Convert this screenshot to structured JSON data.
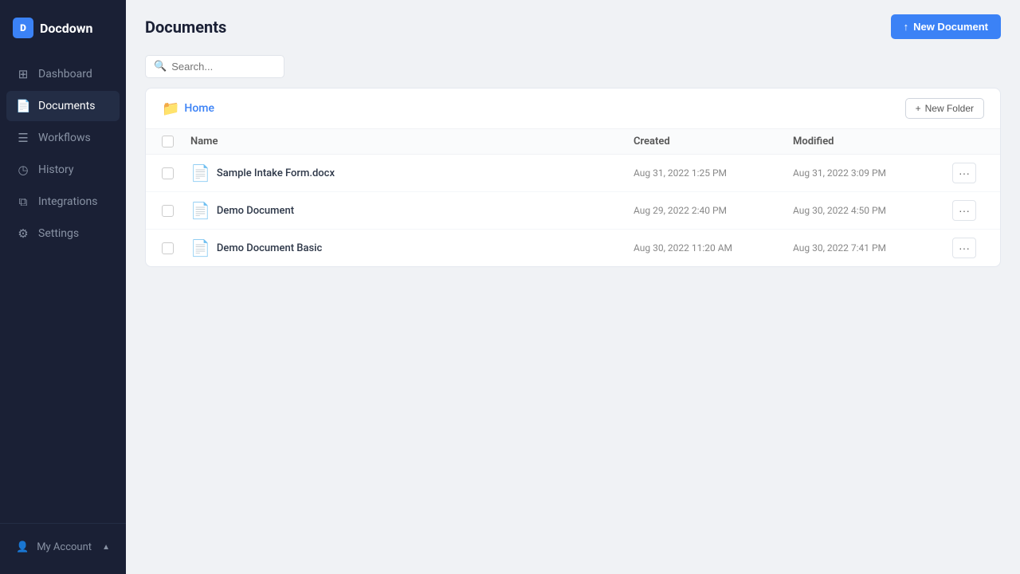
{
  "app": {
    "name": "Docdown",
    "logo_char": "D"
  },
  "sidebar": {
    "nav_items": [
      {
        "id": "dashboard",
        "label": "Dashboard",
        "icon": "⊞",
        "active": false
      },
      {
        "id": "documents",
        "label": "Documents",
        "icon": "📄",
        "active": true
      },
      {
        "id": "workflows",
        "label": "Workflows",
        "icon": "☰",
        "active": false
      },
      {
        "id": "history",
        "label": "History",
        "icon": "◷",
        "active": false
      },
      {
        "id": "integrations",
        "label": "Integrations",
        "icon": "⧉",
        "active": false
      },
      {
        "id": "settings",
        "label": "Settings",
        "icon": "⚙",
        "active": false
      }
    ],
    "account": {
      "label": "My Account",
      "chevron": "▲"
    }
  },
  "header": {
    "title": "Documents",
    "new_document_label": "New Document",
    "new_document_icon": "↑"
  },
  "search": {
    "placeholder": "Search..."
  },
  "panel": {
    "breadcrumb": "Home",
    "new_folder_label": "New Folder",
    "columns": [
      "Name",
      "Created",
      "Modified"
    ],
    "documents": [
      {
        "id": 1,
        "name": "Sample Intake Form.docx",
        "created": "Aug 31, 2022 1:25 PM",
        "modified": "Aug 31, 2022 3:09 PM"
      },
      {
        "id": 2,
        "name": "Demo Document",
        "created": "Aug 29, 2022 2:40 PM",
        "modified": "Aug 30, 2022 4:50 PM"
      },
      {
        "id": 3,
        "name": "Demo Document Basic",
        "created": "Aug 30, 2022 11:20 AM",
        "modified": "Aug 30, 2022 7:41 PM"
      }
    ]
  },
  "colors": {
    "accent": "#3b82f6",
    "sidebar_bg": "#1a2035",
    "doc_icon_color": "#e53e3e"
  }
}
